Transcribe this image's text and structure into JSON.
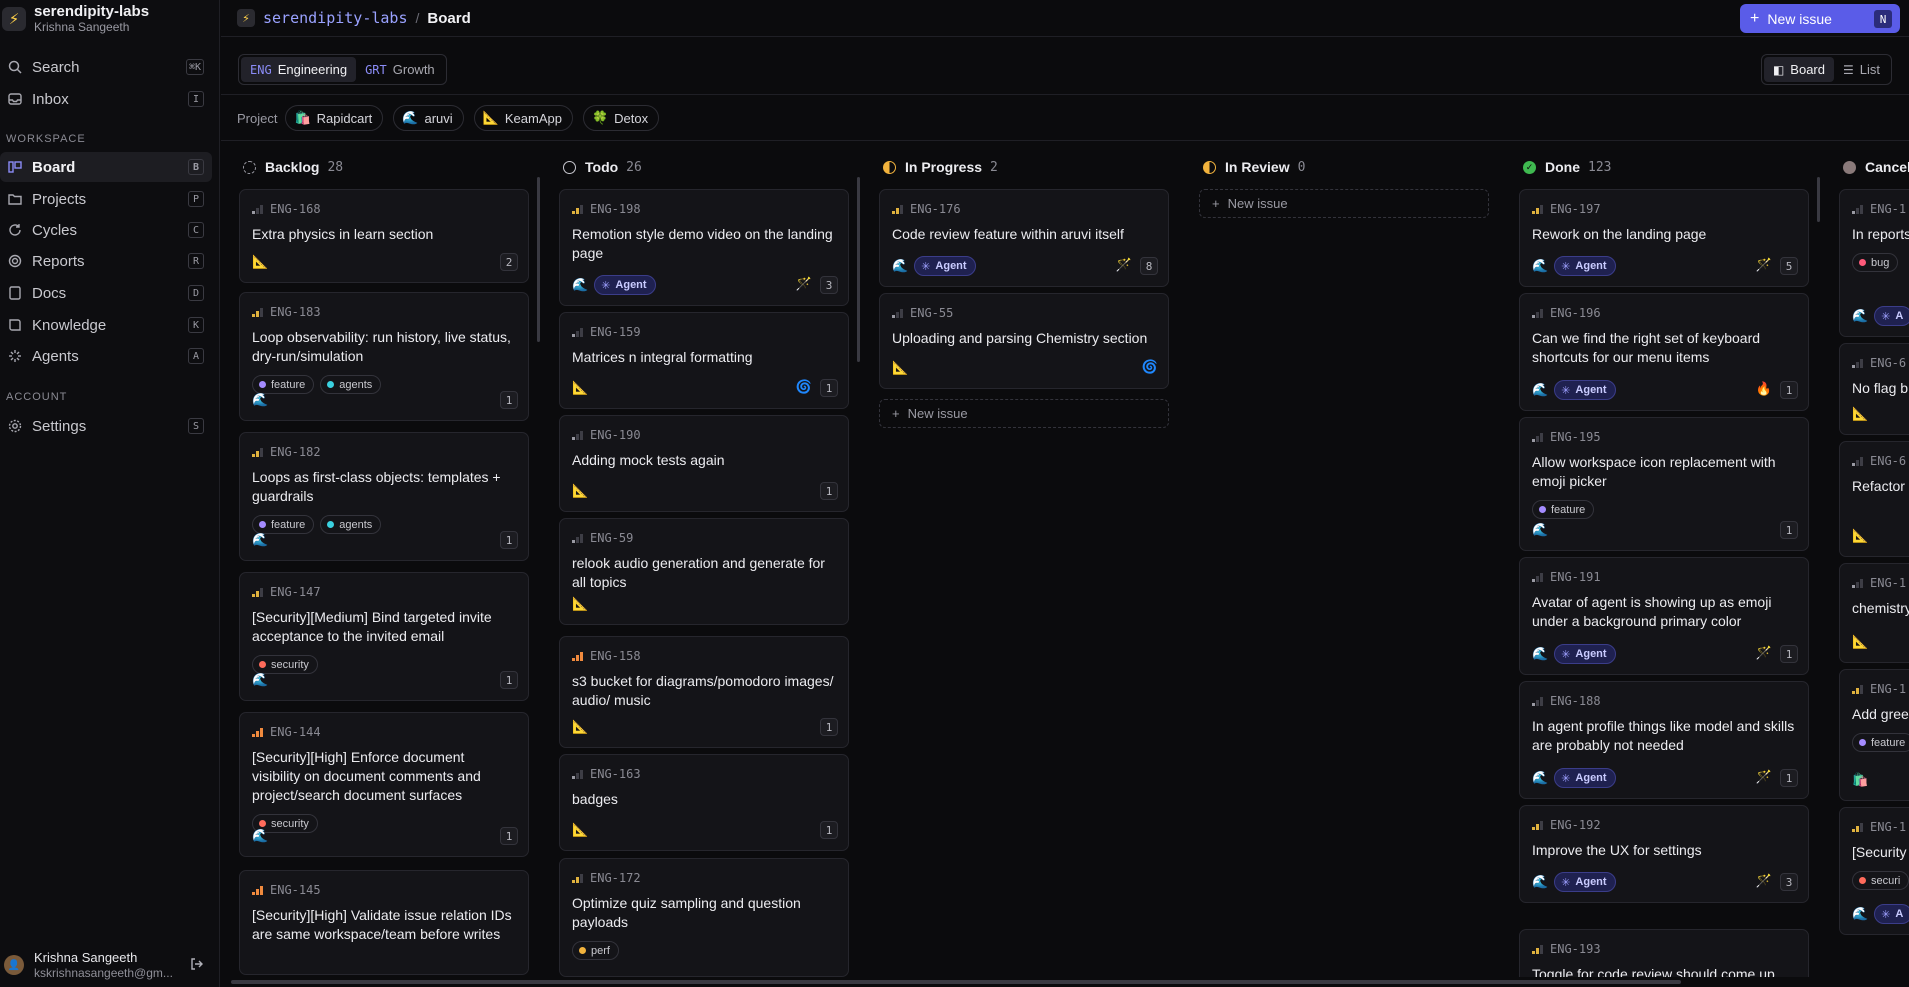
{
  "workspace": {
    "name": "serendipity-labs",
    "user": "Krishna Sangeeth"
  },
  "sidebar": {
    "nav": [
      {
        "label": "Search",
        "key": "⌘K",
        "icon": "search-icon"
      },
      {
        "label": "Inbox",
        "key": "I",
        "icon": "inbox-icon"
      }
    ],
    "workspace_label": "WORKSPACE",
    "workspace_items": [
      {
        "label": "Board",
        "key": "B",
        "icon": "board-icon"
      },
      {
        "label": "Projects",
        "key": "P",
        "icon": "folder-icon"
      },
      {
        "label": "Cycles",
        "key": "C",
        "icon": "cycle-icon"
      },
      {
        "label": "Reports",
        "key": "R",
        "icon": "target-icon"
      },
      {
        "label": "Docs",
        "key": "D",
        "icon": "docs-icon"
      },
      {
        "label": "Knowledge",
        "key": "K",
        "icon": "book-icon"
      },
      {
        "label": "Agents",
        "key": "A",
        "icon": "sparkle-icon"
      }
    ],
    "account_label": "ACCOUNT",
    "account_items": [
      {
        "label": "Settings",
        "key": "S",
        "icon": "gear-icon"
      }
    ],
    "user": {
      "name": "Krishna Sangeeth",
      "email": "kskrishnasangeeth@gm..."
    }
  },
  "topbar": {
    "workspace": "serendipity-labs",
    "separator": "/",
    "page": "Board",
    "new_issue_label": "New issue",
    "new_issue_key": "N"
  },
  "teams": [
    {
      "code": "ENG",
      "name": "Engineering"
    },
    {
      "code": "GRT",
      "name": "Growth"
    }
  ],
  "views": [
    {
      "icon": "board-icon",
      "label": "Board"
    },
    {
      "icon": "list-icon",
      "label": "List"
    }
  ],
  "project_label": "Project",
  "projects": [
    {
      "emoji": "🛍️",
      "name": "Rapidcart"
    },
    {
      "emoji": "🌊",
      "name": "aruvi"
    },
    {
      "emoji": "📐",
      "name": "KeamApp"
    },
    {
      "emoji": "🍀",
      "name": "Detox"
    }
  ],
  "new_issue_label": "New issue",
  "columns": [
    {
      "name": "Backlog",
      "count": "28",
      "cards": [
        {
          "id": "ENG-168",
          "prio": "low",
          "title": "Extra physics in learn section",
          "project": "📐",
          "count": "2"
        },
        {
          "id": "ENG-183",
          "prio": "med",
          "title": "Loop observability: run history, live status, dry-run/simulation",
          "tags": [
            {
              "name": "feature",
              "color": "#a48bff"
            },
            {
              "name": "agents",
              "color": "#3ad1e0"
            }
          ],
          "project": "🌊",
          "count": "1"
        },
        {
          "id": "ENG-182",
          "prio": "med",
          "title": "Loops as first-class objects: templates + guardrails",
          "tags": [
            {
              "name": "feature",
              "color": "#a48bff"
            },
            {
              "name": "agents",
              "color": "#3ad1e0"
            }
          ],
          "project": "🌊",
          "count": "1"
        },
        {
          "id": "ENG-147",
          "prio": "med",
          "title": "[Security][Medium] Bind targeted invite acceptance to the invited email",
          "tags": [
            {
              "name": "security",
              "color": "#ff6b5b"
            }
          ],
          "project": "🌊",
          "count": "1"
        },
        {
          "id": "ENG-144",
          "prio": "high",
          "title": "[Security][High] Enforce document visibility on document comments and project/search document surfaces",
          "tags": [
            {
              "name": "security",
              "color": "#ff6b5b"
            }
          ],
          "project": "🌊",
          "count": "1"
        },
        {
          "id": "ENG-145",
          "prio": "high",
          "title": "[Security][High] Validate issue relation IDs are same workspace/team before writes"
        }
      ]
    },
    {
      "name": "Todo",
      "count": "26",
      "cards": [
        {
          "id": "ENG-198",
          "prio": "med",
          "title": "Remotion style demo video on the landing page",
          "project": "🌊",
          "agent": "Agent",
          "aux": "🪄",
          "count": "3"
        },
        {
          "id": "ENG-159",
          "prio": "low",
          "title": "Matrices n integral formatting",
          "project": "📐",
          "aux": "🌀",
          "count": "1"
        },
        {
          "id": "ENG-190",
          "prio": "low",
          "title": "Adding mock tests again",
          "project": "📐",
          "count": "1"
        },
        {
          "id": "ENG-59",
          "prio": "low",
          "title": "relook audio generation and generate for all topics",
          "project": "📐"
        },
        {
          "id": "ENG-158",
          "prio": "high",
          "title": "s3 bucket for diagrams/pomodoro images/ audio/ music",
          "project": "📐",
          "count": "1"
        },
        {
          "id": "ENG-163",
          "prio": "low",
          "title": "badges",
          "project": "📐",
          "count": "1"
        },
        {
          "id": "ENG-172",
          "prio": "med",
          "title": "Optimize quiz sampling and question payloads",
          "tags": [
            {
              "name": "perf",
              "color": "#f2b33d"
            }
          ]
        }
      ]
    },
    {
      "name": "In Progress",
      "count": "2",
      "cards": [
        {
          "id": "ENG-176",
          "prio": "med",
          "title": "Code review feature within aruvi itself",
          "project": "🌊",
          "agent": "Agent",
          "aux": "🪄",
          "count": "8"
        },
        {
          "id": "ENG-55",
          "prio": "low",
          "title": "Uploading and parsing Chemistry section",
          "project": "📐",
          "aux": "🌀"
        }
      ]
    },
    {
      "name": "In Review",
      "count": "0",
      "cards": []
    },
    {
      "name": "Done",
      "count": "123",
      "cards": [
        {
          "id": "ENG-197",
          "prio": "med",
          "title": "Rework on the landing page",
          "project": "🌊",
          "agent": "Agent",
          "aux": "🪄",
          "count": "5"
        },
        {
          "id": "ENG-196",
          "prio": "low",
          "title": "Can we find the right set of keyboard shortcuts for our menu items",
          "project": "🌊",
          "agent": "Agent",
          "aux": "🔥",
          "count": "1"
        },
        {
          "id": "ENG-195",
          "prio": "low",
          "title": "Allow workspace icon replacement with emoji picker",
          "tags": [
            {
              "name": "feature",
              "color": "#a48bff"
            }
          ],
          "project": "🌊",
          "count": "1"
        },
        {
          "id": "ENG-191",
          "prio": "low",
          "title": "Avatar of agent is showing up as emoji under a background primary color",
          "project": "🌊",
          "agent": "Agent",
          "aux": "🪄",
          "count": "1"
        },
        {
          "id": "ENG-188",
          "prio": "low",
          "title": "In agent profile things like model and skills are probably not needed",
          "project": "🌊",
          "agent": "Agent",
          "aux": "🪄",
          "count": "1"
        },
        {
          "id": "ENG-192",
          "prio": "med",
          "title": "Improve the UX for settings",
          "project": "🌊",
          "agent": "Agent",
          "aux": "🪄",
          "count": "3"
        },
        {
          "id": "ENG-193",
          "prio": "med",
          "title": "Toggle for code review should come up"
        }
      ]
    },
    {
      "name": "Cancel",
      "count": "",
      "cards": [
        {
          "id": "ENG-1",
          "prio": "low",
          "title": "In reports complete Yesterday",
          "tags": [
            {
              "name": "bug",
              "color": "#ff5a7a"
            }
          ],
          "project": "🌊",
          "agent": "A"
        },
        {
          "id": "ENG-6",
          "prio": "low",
          "title": "No flag b",
          "project": "📐"
        },
        {
          "id": "ENG-6",
          "prio": "low",
          "title": "Refactor ORM/Co",
          "project": "📐"
        },
        {
          "id": "ENG-1",
          "prio": "low",
          "title": "chemistry",
          "project": "📐"
        },
        {
          "id": "ENG-1",
          "prio": "med",
          "title": "Add gree across Ra",
          "tags": [
            {
              "name": "feature",
              "color": "#a48bff"
            }
          ],
          "project": "🛍️"
        },
        {
          "id": "ENG-1",
          "prio": "med",
          "title": "[Security producti drizzle-o",
          "tags": [
            {
              "name": "securi",
              "color": "#ff6b5b"
            }
          ],
          "project": "🌊",
          "agent": "A"
        }
      ]
    }
  ]
}
